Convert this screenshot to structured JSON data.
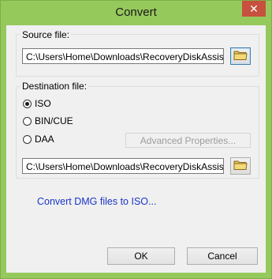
{
  "window": {
    "title": "Convert",
    "close_glyph": "✕"
  },
  "source": {
    "label": "Source file:",
    "path": "C:\\Users\\Home\\Downloads\\RecoveryDiskAssistant.dmg"
  },
  "destination": {
    "label": "Destination file:",
    "options": [
      {
        "label": "ISO",
        "checked": true
      },
      {
        "label": "BIN/CUE",
        "checked": false
      },
      {
        "label": "DAA",
        "checked": false
      }
    ],
    "advanced_label": "Advanced Properties...",
    "path": "C:\\Users\\Home\\Downloads\\RecoveryDiskAssistant.iso"
  },
  "link_text": "Convert DMG files to ISO...",
  "buttons": {
    "ok": "OK",
    "cancel": "Cancel"
  },
  "icons": {
    "folder": "folder-icon",
    "close": "close-icon"
  }
}
